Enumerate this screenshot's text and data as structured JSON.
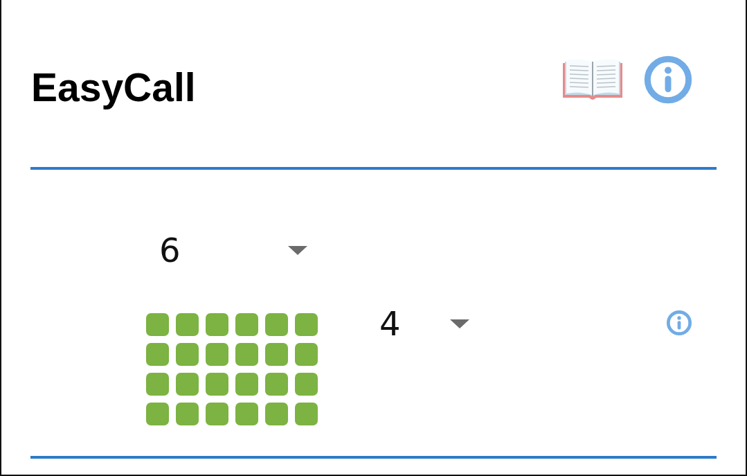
{
  "title": "EasyCall",
  "column_dropdown": {
    "value": "6"
  },
  "row_dropdown": {
    "value": "4"
  }
}
